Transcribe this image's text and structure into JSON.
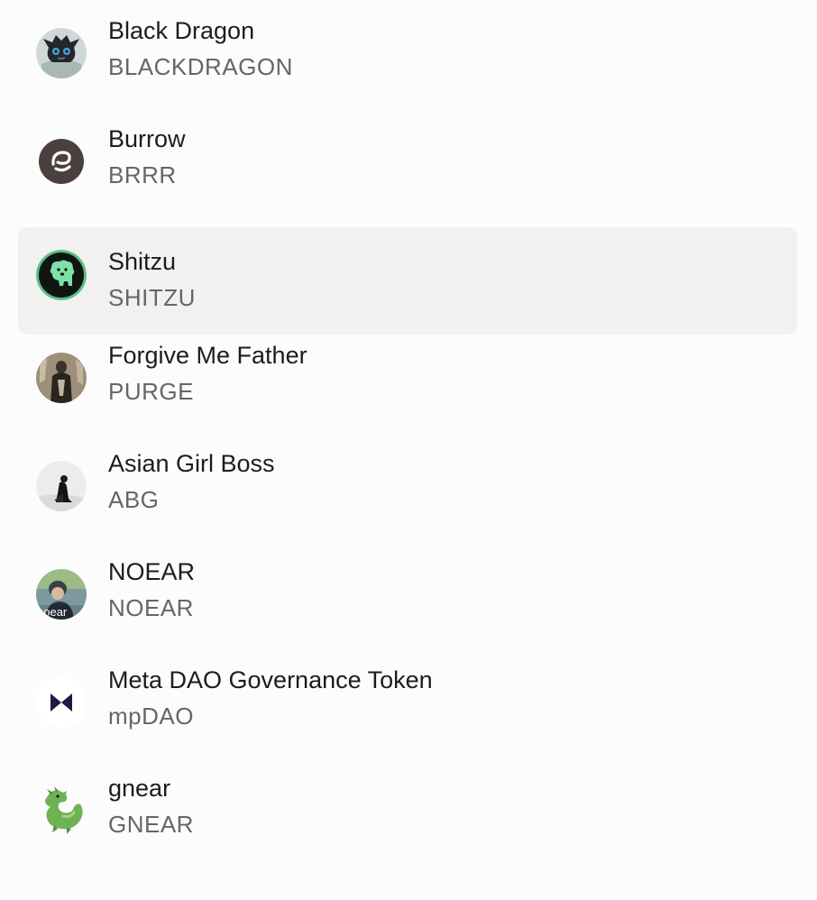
{
  "tokens": [
    {
      "name": "Black Dragon",
      "symbol": "BLACKDRAGON",
      "icon": "black-dragon-icon",
      "selected": false
    },
    {
      "name": "Burrow",
      "symbol": "BRRR",
      "icon": "burrow-icon",
      "selected": false
    },
    {
      "name": "Shitzu",
      "symbol": "SHITZU",
      "icon": "shitzu-icon",
      "selected": true
    },
    {
      "name": "Forgive Me Father",
      "symbol": "PURGE",
      "icon": "forgive-me-father-icon",
      "selected": false
    },
    {
      "name": "Asian Girl Boss",
      "symbol": "ABG",
      "icon": "asian-girl-boss-icon",
      "selected": false
    },
    {
      "name": "NOEAR",
      "symbol": "NOEAR",
      "icon": "noear-icon",
      "icon_text": "noear",
      "selected": false
    },
    {
      "name": "Meta DAO Governance Token",
      "symbol": "mpDAO",
      "icon": "meta-dao-icon",
      "selected": false
    },
    {
      "name": "gnear",
      "symbol": "GNEAR",
      "icon": "gnear-icon",
      "selected": false
    }
  ],
  "colors": {
    "selected_row_bg": "#f1f1f0",
    "name_text": "#1c1c1c",
    "symbol_text": "#666666",
    "shitzu_green": "#7ee0a6",
    "meta_dao_navy": "#1e1b4b",
    "gnear_green": "#6fb256"
  }
}
